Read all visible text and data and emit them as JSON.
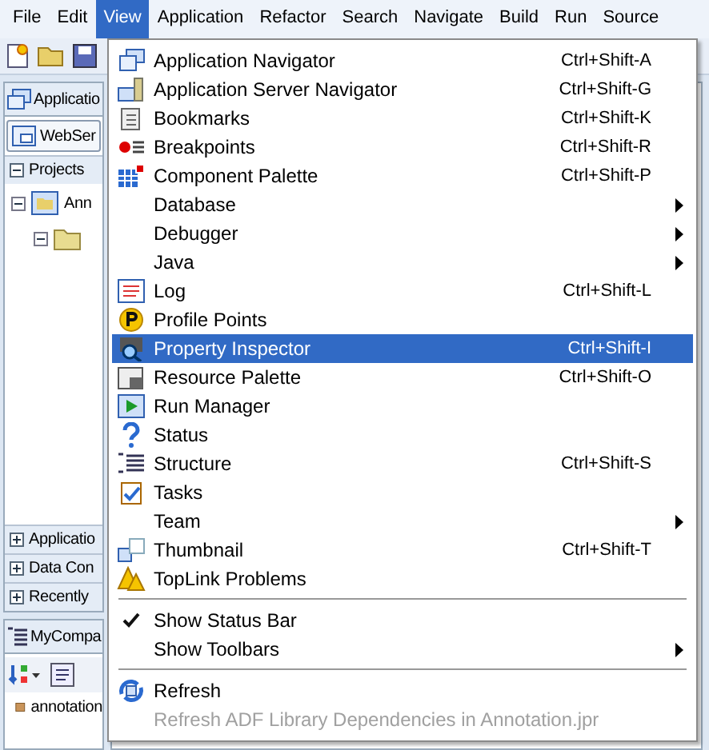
{
  "menubar": [
    {
      "label": "File",
      "selected": false
    },
    {
      "label": "Edit",
      "selected": false
    },
    {
      "label": "View",
      "selected": true
    },
    {
      "label": "Application",
      "selected": false
    },
    {
      "label": "Refactor",
      "selected": false
    },
    {
      "label": "Search",
      "selected": false
    },
    {
      "label": "Navigate",
      "selected": false
    },
    {
      "label": "Build",
      "selected": false
    },
    {
      "label": "Run",
      "selected": false
    },
    {
      "label": "Source",
      "selected": false
    }
  ],
  "left_panel": {
    "tabs": [
      "Applicatio",
      "WebSer"
    ],
    "projects": "Projects",
    "tree_root": "Ann",
    "accordion": [
      "Applicatio",
      "Data Con",
      "Recently"
    ],
    "structure_title": "MyCompa",
    "structure_item": "annotation"
  },
  "menu": {
    "items": [
      {
        "kind": "item",
        "label": "Application Navigator",
        "shortcut": "Ctrl+Shift-A",
        "submenu": false,
        "selected": false,
        "disabled": false,
        "checked": false
      },
      {
        "kind": "item",
        "label": "Application Server Navigator",
        "shortcut": "Ctrl+Shift-G",
        "submenu": false,
        "selected": false,
        "disabled": false,
        "checked": false
      },
      {
        "kind": "item",
        "label": "Bookmarks",
        "shortcut": "Ctrl+Shift-K",
        "submenu": false,
        "selected": false,
        "disabled": false,
        "checked": false
      },
      {
        "kind": "item",
        "label": "Breakpoints",
        "shortcut": "Ctrl+Shift-R",
        "submenu": false,
        "selected": false,
        "disabled": false,
        "checked": false
      },
      {
        "kind": "item",
        "label": "Component Palette",
        "shortcut": "Ctrl+Shift-P",
        "submenu": false,
        "selected": false,
        "disabled": false,
        "checked": false
      },
      {
        "kind": "item",
        "label": "Database",
        "submenu": true,
        "selected": false,
        "disabled": false,
        "checked": false
      },
      {
        "kind": "item",
        "label": "Debugger",
        "submenu": true,
        "selected": false,
        "disabled": false,
        "checked": false
      },
      {
        "kind": "item",
        "label": "Java",
        "submenu": true,
        "selected": false,
        "disabled": false,
        "checked": false
      },
      {
        "kind": "item",
        "label": "Log",
        "shortcut": "Ctrl+Shift-L",
        "submenu": false,
        "selected": false,
        "disabled": false,
        "checked": false
      },
      {
        "kind": "item",
        "label": "Profile Points",
        "submenu": false,
        "selected": false,
        "disabled": false,
        "checked": false
      },
      {
        "kind": "item",
        "label": "Property Inspector",
        "shortcut": "Ctrl+Shift-I",
        "submenu": false,
        "selected": true,
        "disabled": false,
        "checked": false
      },
      {
        "kind": "item",
        "label": "Resource Palette",
        "shortcut": "Ctrl+Shift-O",
        "submenu": false,
        "selected": false,
        "disabled": false,
        "checked": false
      },
      {
        "kind": "item",
        "label": "Run Manager",
        "submenu": false,
        "selected": false,
        "disabled": false,
        "checked": false
      },
      {
        "kind": "item",
        "label": "Status",
        "submenu": false,
        "selected": false,
        "disabled": false,
        "checked": false
      },
      {
        "kind": "item",
        "label": "Structure",
        "shortcut": "Ctrl+Shift-S",
        "submenu": false,
        "selected": false,
        "disabled": false,
        "checked": false
      },
      {
        "kind": "item",
        "label": "Tasks",
        "submenu": false,
        "selected": false,
        "disabled": false,
        "checked": false
      },
      {
        "kind": "item",
        "label": "Team",
        "submenu": true,
        "selected": false,
        "disabled": false,
        "checked": false
      },
      {
        "kind": "item",
        "label": "Thumbnail",
        "shortcut": "Ctrl+Shift-T",
        "submenu": false,
        "selected": false,
        "disabled": false,
        "checked": false
      },
      {
        "kind": "item",
        "label": "TopLink Problems",
        "submenu": false,
        "selected": false,
        "disabled": false,
        "checked": false
      },
      {
        "kind": "separator"
      },
      {
        "kind": "item",
        "label": "Show Status Bar",
        "submenu": false,
        "selected": false,
        "disabled": false,
        "checked": true
      },
      {
        "kind": "item",
        "label": "Show Toolbars",
        "submenu": true,
        "selected": false,
        "disabled": false,
        "checked": false
      },
      {
        "kind": "separator"
      },
      {
        "kind": "item",
        "label": "Refresh",
        "submenu": false,
        "selected": false,
        "disabled": false,
        "checked": false
      },
      {
        "kind": "item",
        "label": "Refresh ADF Library Dependencies in Annotation.jpr",
        "submenu": false,
        "selected": false,
        "disabled": true,
        "checked": false
      }
    ]
  }
}
